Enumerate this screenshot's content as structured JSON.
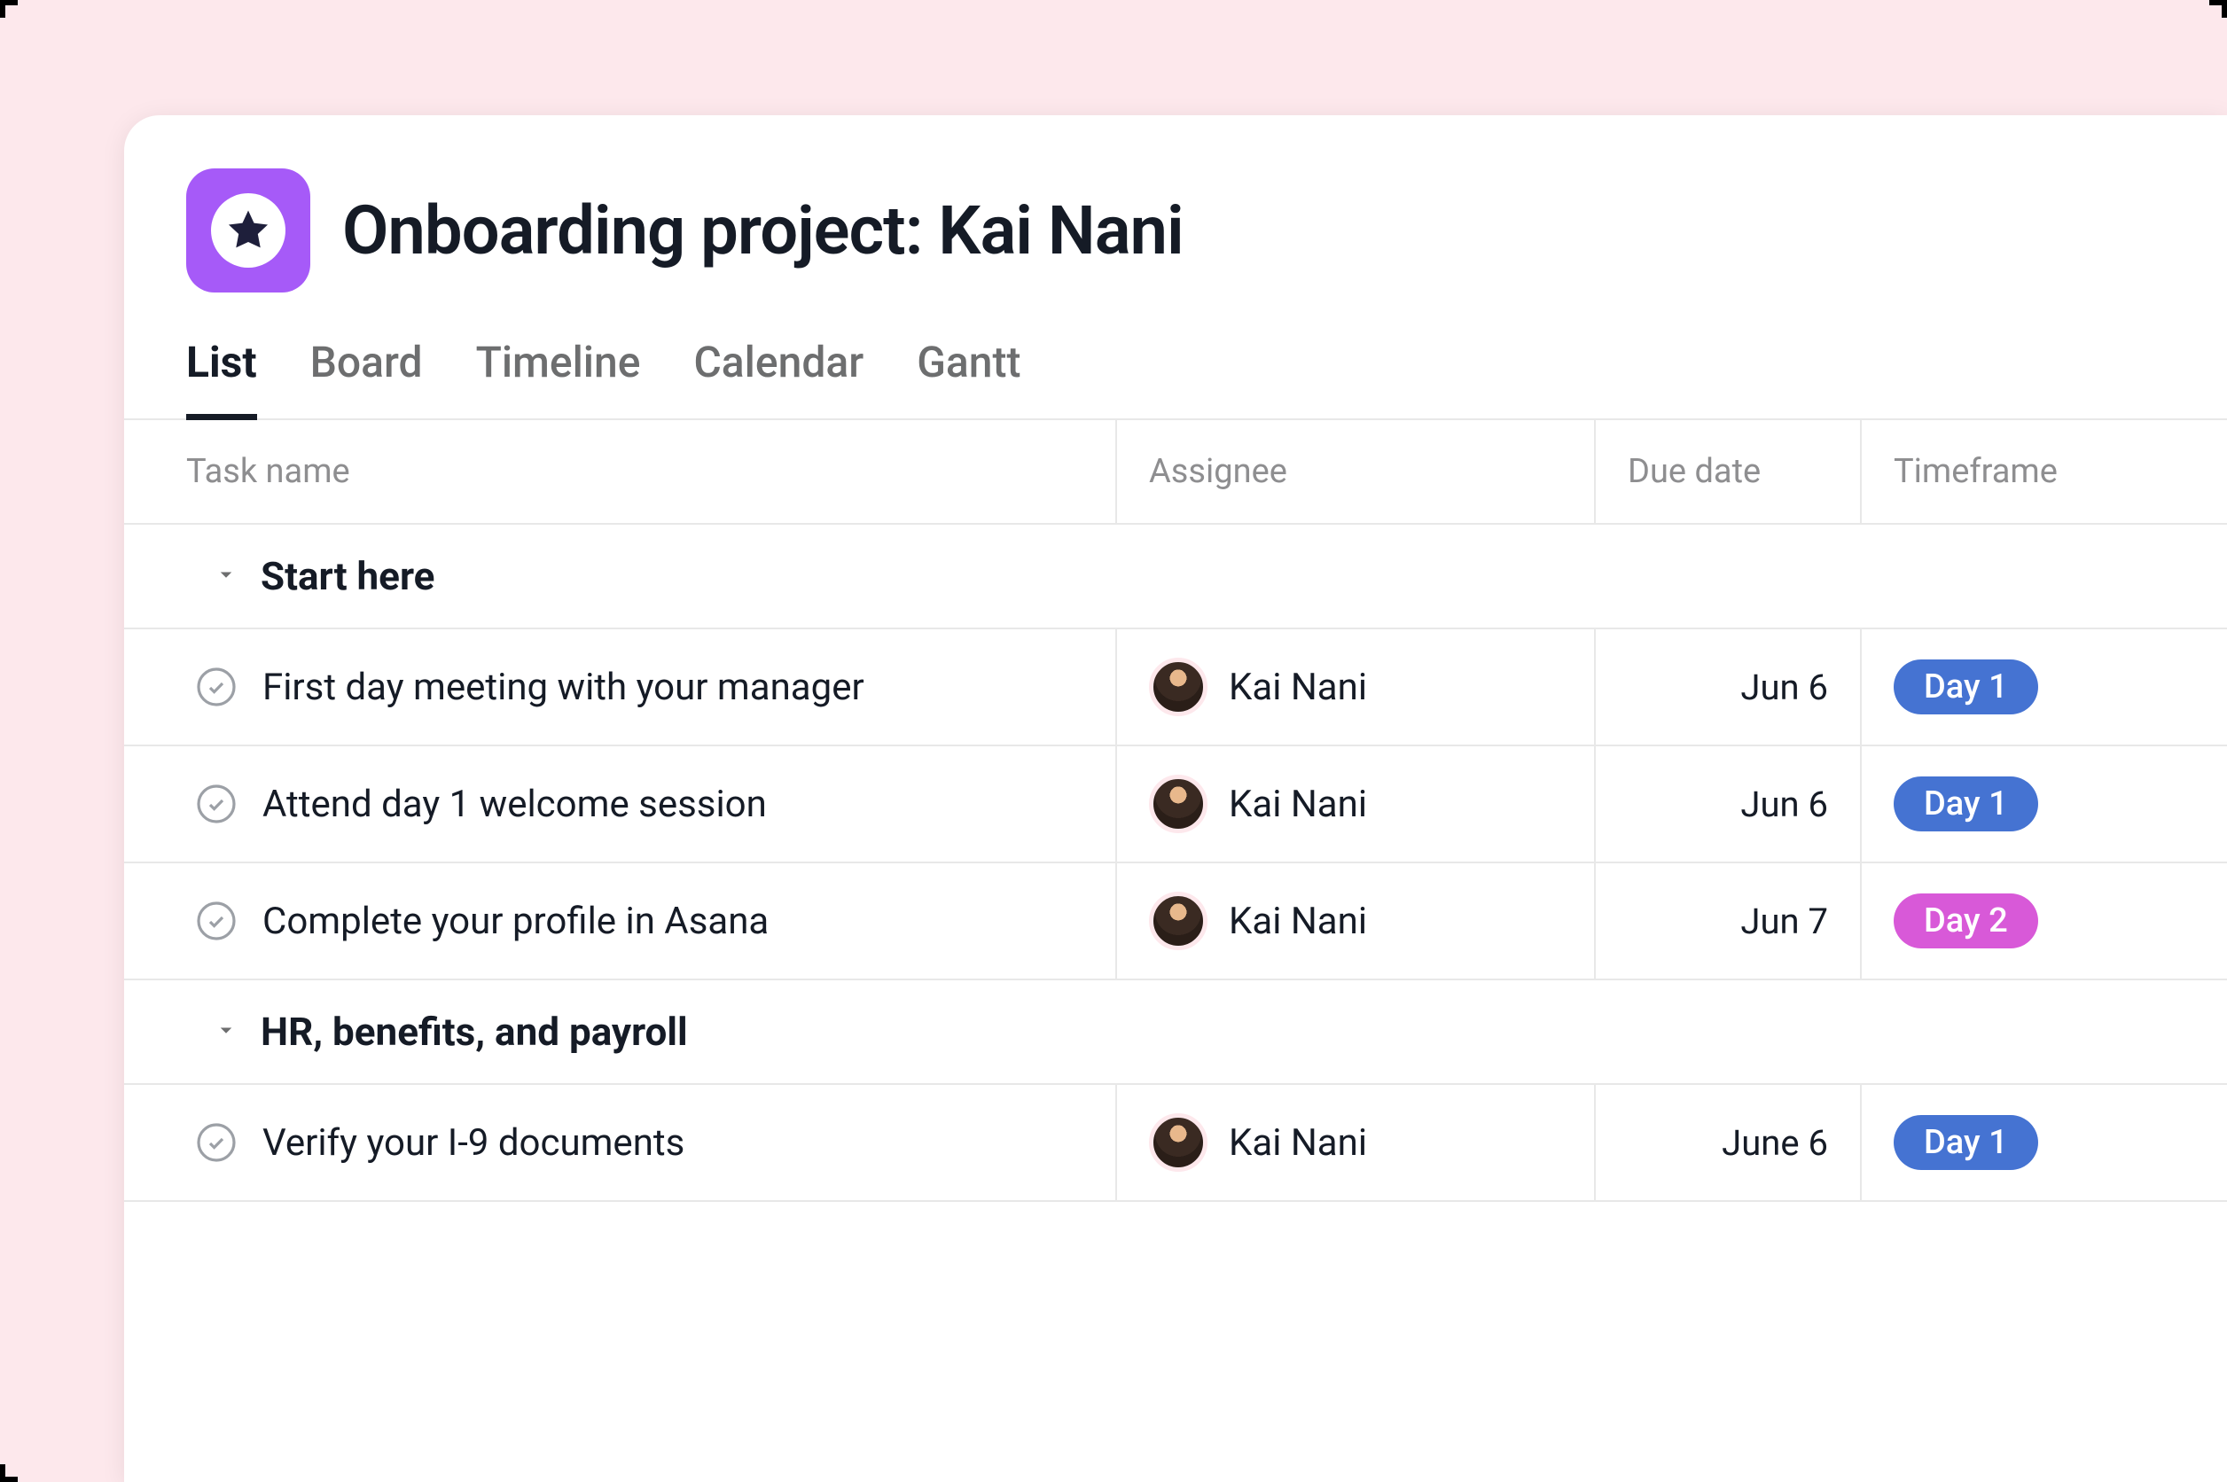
{
  "project": {
    "title": "Onboarding project: Kai Nani",
    "icon": "star-icon",
    "icon_bg": "#a65af8"
  },
  "tabs": [
    {
      "label": "List",
      "active": true
    },
    {
      "label": "Board",
      "active": false
    },
    {
      "label": "Timeline",
      "active": false
    },
    {
      "label": "Calendar",
      "active": false
    },
    {
      "label": "Gantt",
      "active": false
    }
  ],
  "columns": {
    "task_name": "Task name",
    "assignee": "Assignee",
    "due_date": "Due date",
    "timeframe": "Timeframe"
  },
  "sections": [
    {
      "title": "Start here",
      "tasks": [
        {
          "name": "First day meeting with your manager",
          "assignee": "Kai Nani",
          "due": "Jun 6",
          "timeframe": {
            "label": "Day 1",
            "color": "blue"
          }
        },
        {
          "name": "Attend day 1 welcome session",
          "assignee": "Kai Nani",
          "due": "Jun 6",
          "timeframe": {
            "label": "Day 1",
            "color": "blue"
          }
        },
        {
          "name": "Complete your profile in Asana",
          "assignee": "Kai Nani",
          "due": "Jun 7",
          "timeframe": {
            "label": "Day 2",
            "color": "pink"
          }
        }
      ]
    },
    {
      "title": "HR, benefits, and payroll",
      "tasks": [
        {
          "name": "Verify your I-9 documents",
          "assignee": "Kai Nani",
          "due": "June 6",
          "timeframe": {
            "label": "Day 1",
            "color": "blue"
          }
        }
      ]
    }
  ]
}
